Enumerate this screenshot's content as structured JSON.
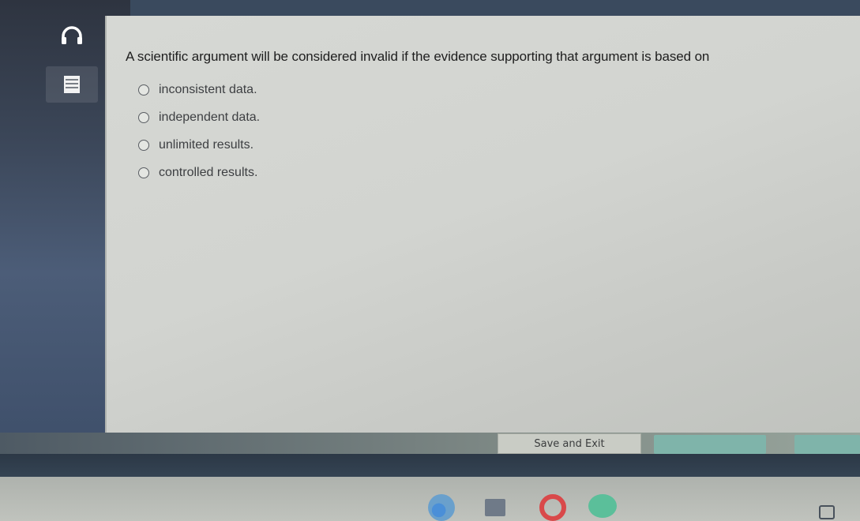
{
  "question": {
    "text": "A scientific argument will be considered invalid if the evidence supporting that argument is based on"
  },
  "choices": [
    {
      "label": "inconsistent data."
    },
    {
      "label": "independent data."
    },
    {
      "label": "unlimited results."
    },
    {
      "label": "controlled results."
    }
  ],
  "footer": {
    "save_exit_label": "Save and Exit"
  },
  "icons": {
    "audio": "headphones-icon",
    "notes": "notepad-icon"
  },
  "colors": {
    "content_bg": "#d2d4d0",
    "accent_button": "#7fb4aa"
  }
}
